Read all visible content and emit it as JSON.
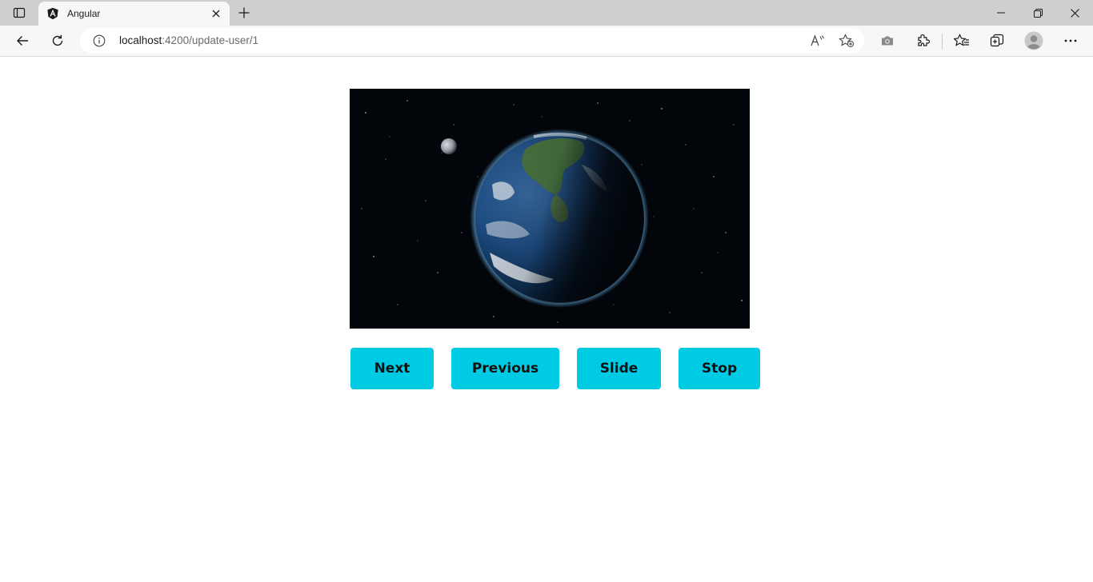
{
  "browser": {
    "tab": {
      "title": "Angular",
      "favicon": "angular-logo-icon"
    },
    "address": {
      "host": "localhost",
      "path": ":4200/update-user/1"
    },
    "toolbar_icons": [
      "back-icon",
      "refresh-icon",
      "read-aloud-icon",
      "add-favorite-icon",
      "screenshot-icon",
      "extensions-icon",
      "favorites-icon",
      "collections-icon",
      "profile-icon",
      "more-icon"
    ],
    "window_controls": [
      "minimize-icon",
      "restore-icon",
      "close-icon"
    ]
  },
  "slideshow": {
    "image": {
      "subject": "earth-from-space",
      "background": "#020509"
    },
    "buttons": {
      "next": "Next",
      "previous": "Previous",
      "slide": "Slide",
      "stop": "Stop"
    },
    "button_color": "#00cbe5"
  }
}
